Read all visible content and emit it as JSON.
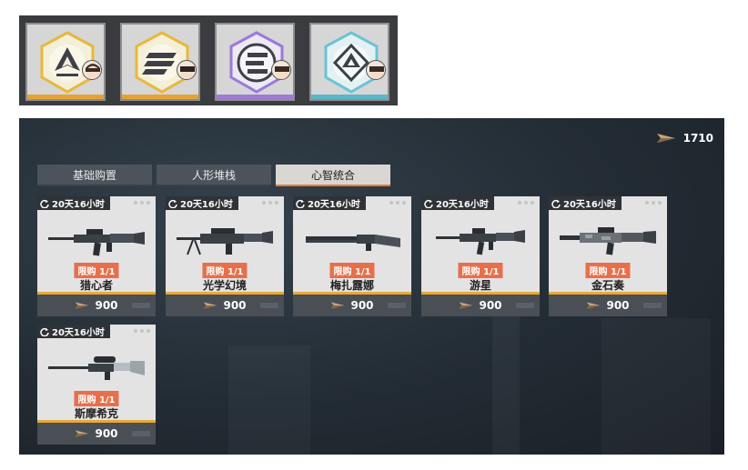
{
  "badges": [
    {
      "name": "badge-card-1",
      "bar_color": "#e3a333",
      "emblem": "mountain-emblem",
      "ring_color": "#e7b83a"
    },
    {
      "name": "badge-card-2",
      "bar_color": "#e3a333",
      "emblem": "stripes-emblem",
      "ring_color": "#e7b83a"
    },
    {
      "name": "badge-card-3",
      "bar_color": "#a07ad6",
      "emblem": "e-shield-emblem",
      "ring_color": "#9a7ad8"
    },
    {
      "name": "badge-card-4",
      "bar_color": "#5bb6c8",
      "emblem": "peak-diamond-emblem",
      "ring_color": "#6bc3d3"
    }
  ],
  "shop": {
    "currency_amount": "1710",
    "currency_icon": "crystal-currency-icon",
    "tabs": [
      "基础购置",
      "人形堆栈",
      "心智统合"
    ],
    "active_tab": 2,
    "items": [
      {
        "timer": "20天16小时",
        "limit": "限购 1/1",
        "name": "猎心者",
        "price": "900"
      },
      {
        "timer": "20天16小时",
        "limit": "限购 1/1",
        "name": "光学幻境",
        "price": "900"
      },
      {
        "timer": "20天16小时",
        "limit": "限购 1/1",
        "name": "梅扎露娜",
        "price": "900"
      },
      {
        "timer": "20天16小时",
        "limit": "限购 1/1",
        "name": "游星",
        "price": "900"
      },
      {
        "timer": "20天16小时",
        "limit": "限购 1/1",
        "name": "金石奏",
        "price": "900"
      },
      {
        "timer": "20天16小时",
        "limit": "限购 1/1",
        "name": "斯摩希克",
        "price": "900"
      }
    ]
  },
  "colors": {
    "accent_orange": "#e8a93a",
    "limit_badge": "#e86f4a",
    "active_tab_underline": "#e87a2c"
  }
}
